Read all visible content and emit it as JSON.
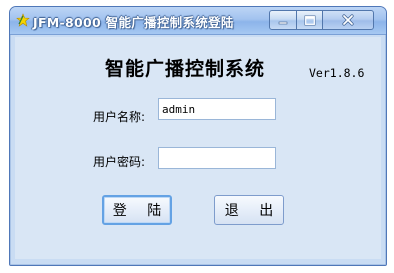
{
  "window": {
    "title": "JFM-8000 智能广播控制系统登陆",
    "controls": {
      "minimize_icon": "minimize-icon",
      "maximize_icon": "maximize-icon",
      "close_icon": "close-icon"
    }
  },
  "main": {
    "heading": "智能广播控制系统",
    "version": "Ver1.8.6"
  },
  "form": {
    "username": {
      "label": "用户名称:",
      "value": "admin"
    },
    "password": {
      "label": "用户密码:",
      "value": ""
    }
  },
  "buttons": {
    "login": "登 陆",
    "exit": "退 出"
  },
  "colors": {
    "titlebar": "#a3c3ef",
    "client_background": "#d9e6f5",
    "focus_border": "#64a2e4"
  }
}
